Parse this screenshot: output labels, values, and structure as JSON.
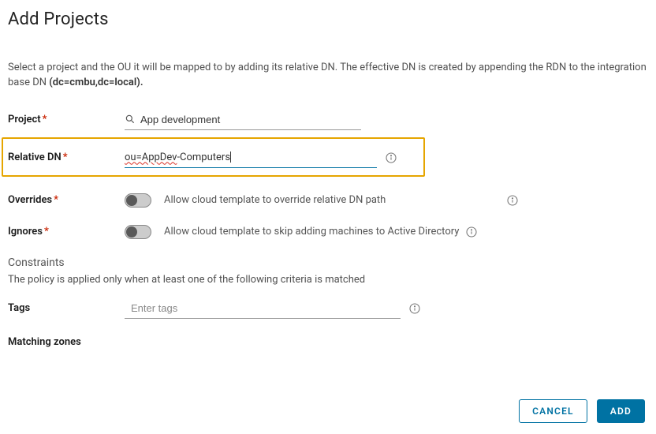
{
  "title": "Add Projects",
  "description_pre": "Select a project and the OU it will be mapped to by adding its relative DN. The effective DN is created by appending the RDN to the integration base DN ",
  "description_bold": "(dc=cmbu,dc=local).",
  "fields": {
    "project": {
      "label": "Project",
      "value": "App development"
    },
    "relative_dn": {
      "label": "Relative DN",
      "value": "ou=AppDev-Computers",
      "display_parts": {
        "squiggled": "ou=AppDev",
        "rest": "-Computers"
      }
    },
    "overrides": {
      "label": "Overrides",
      "toggle_label": "Allow cloud template to override relative DN path",
      "on": false
    },
    "ignores": {
      "label": "Ignores",
      "toggle_label": "Allow cloud template to skip adding machines to Active Directory",
      "on": false
    },
    "tags": {
      "label": "Tags",
      "placeholder": "Enter tags"
    },
    "matching_zones": {
      "label": "Matching zones"
    }
  },
  "constraints": {
    "heading": "Constraints",
    "description": "The policy is applied only when at least one of the following criteria is matched"
  },
  "buttons": {
    "cancel": "CANCEL",
    "add": "ADD"
  }
}
